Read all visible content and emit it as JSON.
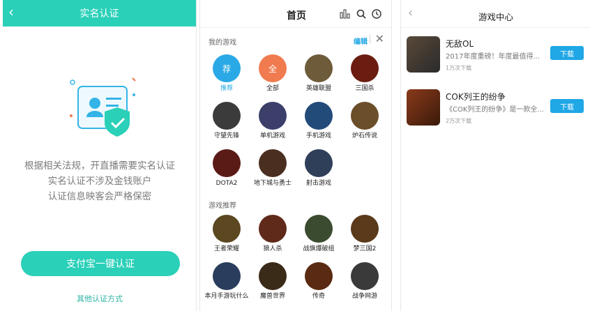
{
  "panel1": {
    "title": "实名认证",
    "back_icon": "chevron-left-icon",
    "lines": [
      "根据相关法规，开直播需要实名认证",
      "实名认证不涉及金钱账户",
      "认证信息映客会严格保密"
    ],
    "primary_button": "支付宝一键认证",
    "secondary_link": "其他认证方式",
    "accent_color": "#2ad0b8"
  },
  "panel2": {
    "title": "首页",
    "icons": {
      "chart": "bar-chart-icon",
      "search": "search-icon",
      "history": "clock-icon"
    },
    "section_my_games": "我的游戏",
    "edit_label": "编辑",
    "close_label": "✕",
    "my_games": [
      {
        "name": "推荐",
        "badge": "荐",
        "color": "#2aa9e6"
      },
      {
        "name": "全部",
        "badge": "全",
        "color": "#f07b4f"
      },
      {
        "name": "英雄联盟",
        "color": "#6d5b3a"
      },
      {
        "name": "三国杀",
        "color": "#6a1d10"
      },
      {
        "name": "守望先锋",
        "color": "#3b3b3b"
      },
      {
        "name": "单机游戏",
        "color": "#3b3f6a"
      },
      {
        "name": "手机游戏",
        "color": "#234b7a"
      },
      {
        "name": "炉石传说",
        "color": "#6b4e2a"
      },
      {
        "name": "DOTA2",
        "color": "#5a1b16"
      },
      {
        "name": "地下城与勇士",
        "color": "#4a2e20"
      },
      {
        "name": "射击游戏",
        "color": "#2f3f59"
      }
    ],
    "section_recommend": "游戏推荐",
    "recommend": [
      {
        "name": "王者荣耀",
        "color": "#5b4720"
      },
      {
        "name": "狼人杀",
        "color": "#5f2a1a"
      },
      {
        "name": "战旗爆破组",
        "color": "#3b4b2f"
      },
      {
        "name": "梦三国2",
        "color": "#5a3a1a"
      },
      {
        "name": "本月手游玩什么",
        "color": "#2b3d5c"
      },
      {
        "name": "魔兽世界",
        "color": "#3a2a18"
      },
      {
        "name": "传奇",
        "color": "#5b2a12"
      },
      {
        "name": "战争网游",
        "color": "#3a3a3a"
      }
    ]
  },
  "panel3": {
    "title": "游戏中心",
    "back_icon": "chevron-left-icon",
    "items": [
      {
        "name": "无敌OL",
        "desc": "2017年度重磅！年度最值得...",
        "count": "1万次下载",
        "button": "下载",
        "thumb_color": "#2a2a2a"
      },
      {
        "name": "COK列王的纷争",
        "desc": "《COK列王的纷争》是一款全...",
        "count": "2万次下载",
        "button": "下载",
        "thumb_color": "#6a2a14"
      }
    ]
  }
}
